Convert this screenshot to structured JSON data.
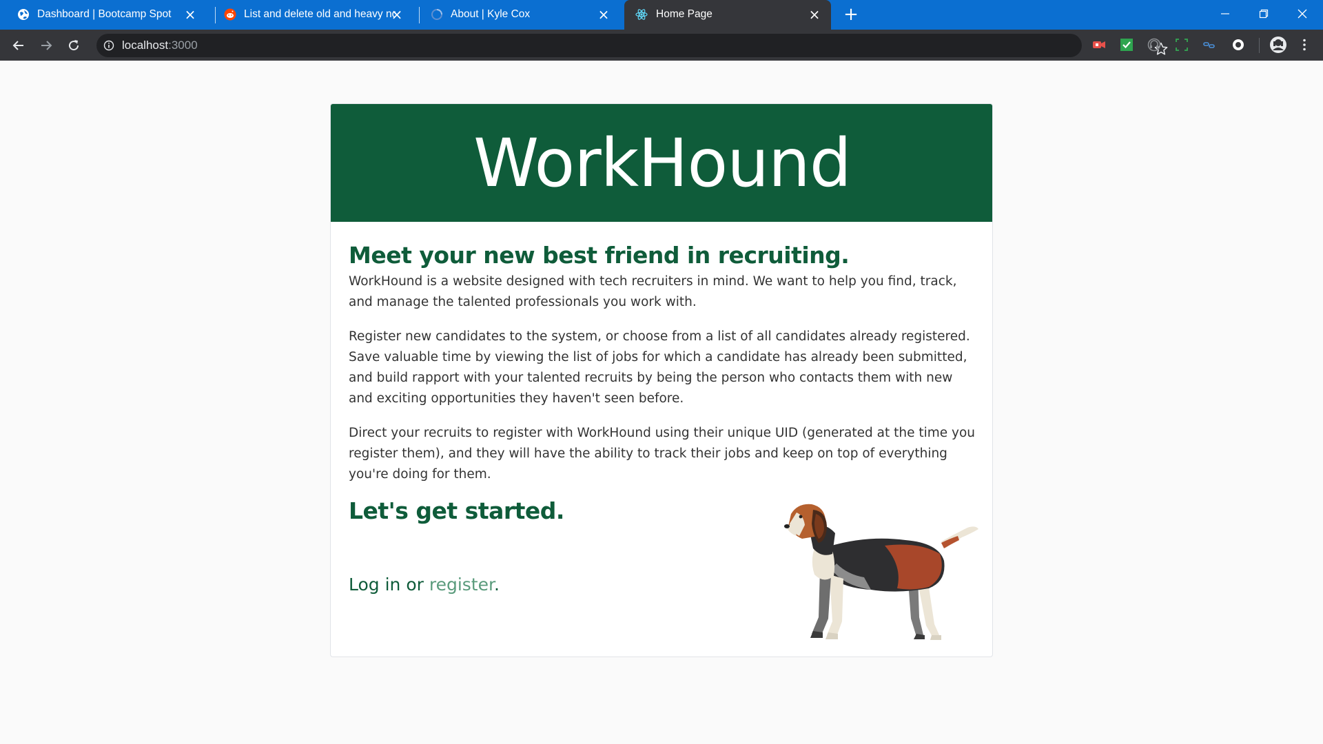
{
  "browser": {
    "tabs": [
      {
        "title": "Dashboard | Bootcamp Spot",
        "favicon": "globe-icon",
        "active": false
      },
      {
        "title": "List and delete old and heavy no",
        "favicon": "reddit-icon",
        "active": false
      },
      {
        "title": "About | Kyle Cox",
        "favicon": "loading-icon",
        "active": false
      },
      {
        "title": "Home Page",
        "favicon": "react-icon",
        "active": true
      }
    ],
    "close_glyph": "×",
    "new_tab_glyph": "+",
    "url_host": "localhost",
    "url_port": ":3000",
    "extensions": [
      "screencast-icon",
      "checkmark-extension-icon",
      "headset-extension-icon",
      "screenshot-extension-icon",
      "link-extension-icon",
      "circle-extension-icon",
      "profile-avatar-icon",
      "kebab-menu-icon"
    ]
  },
  "page": {
    "brand": "WorkHound",
    "headline": "Meet your new best friend in recruiting.",
    "paragraphs": [
      "WorkHound is a website designed with tech recruiters in mind. We want to help you find, track, and manage the talented professionals you work with.",
      "Register new candidates to the system, or choose from a list of all candidates already registered. Save valuable time by viewing the list of jobs for which a candidate has already been submitted, and build rapport with your talented recruits by being the person who contacts them with new and exciting opportunities they haven't seen before.",
      "Direct your recruits to register with WorkHound using their unique UID (generated at the time you register them), and they will have the ability to track their jobs and keep on top of everything you're doing for them."
    ],
    "cta_heading": "Let's get started.",
    "login_label": "Log in",
    "or_label": " or ",
    "register_label": "register",
    "period": "."
  },
  "colors": {
    "tabstrip": "#0b6fd1",
    "toolbar": "#35363a",
    "brand_green": "#0f5c3a",
    "link_green": "#5a9b7c"
  }
}
